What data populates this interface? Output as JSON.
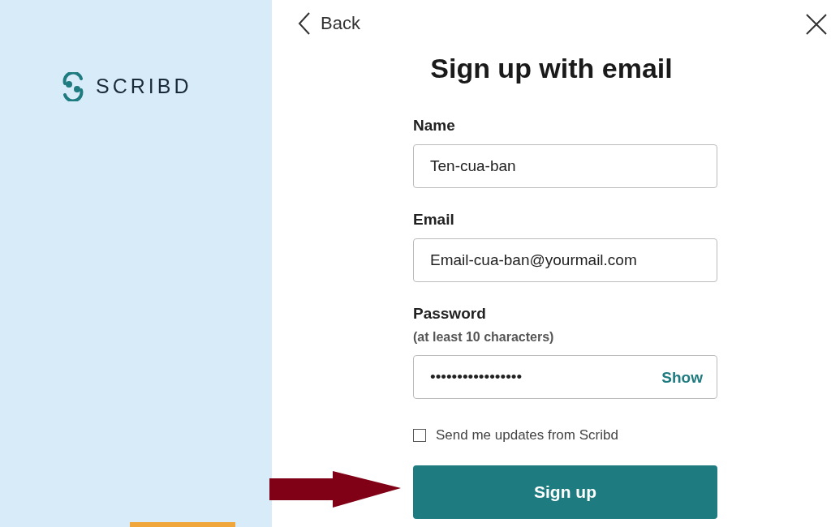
{
  "brand": {
    "name": "SCRIBD"
  },
  "back": "Back",
  "title": "Sign up with email",
  "fields": [
    {
      "label": "Name",
      "value": "Ten-cua-ban"
    },
    {
      "label": "Email",
      "value": "Email-cua-ban@yourmail.com"
    },
    {
      "label": "Password",
      "hint": "(at least 10 characters)",
      "value": "•••••••••••••••••",
      "action": "Show"
    }
  ],
  "updates_checkbox": {
    "label": "Send me updates from Scribd",
    "checked": false
  },
  "submit": "Sign up"
}
